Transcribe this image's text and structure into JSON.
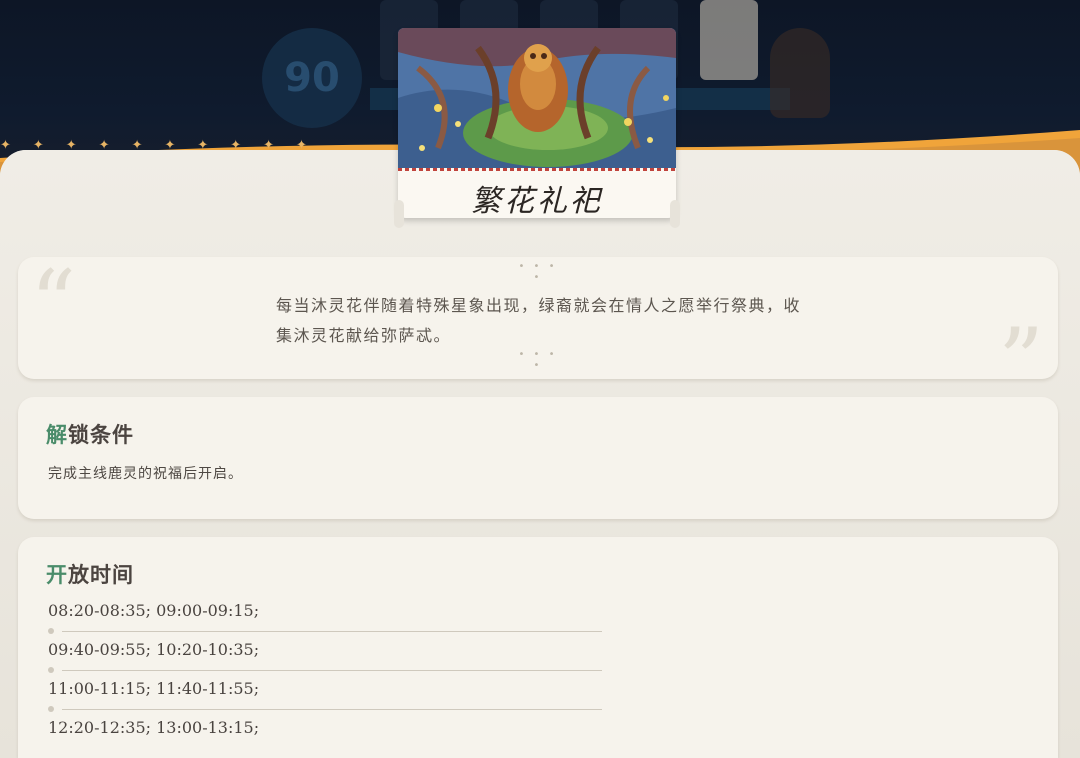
{
  "event": {
    "title": "繁花礼祀",
    "description": "每当沐灵花伴随着特殊星象出现，绿裔就会在情人之愿举行祭典，收集沐灵花献给弥萨忒。"
  },
  "unlock": {
    "heading_accent": "解",
    "heading_rest": "锁条件",
    "text": "完成主线鹿灵的祝福后开启。"
  },
  "schedule": {
    "heading_accent": "开",
    "heading_rest": "放时间",
    "rows": [
      "08:20-08:35;  09:00-09:15;",
      "09:40-09:55;  10:20-10:35;",
      "11:00-11:15;  11:40-11:55;",
      "12:20-12:35;  13:00-13:15;"
    ]
  },
  "backdrop": {
    "badge_text": "90"
  },
  "colors": {
    "accent_green": "#4a8c6a",
    "panel": "#ebe7de",
    "ribbon_gold": "#f0a43a"
  }
}
